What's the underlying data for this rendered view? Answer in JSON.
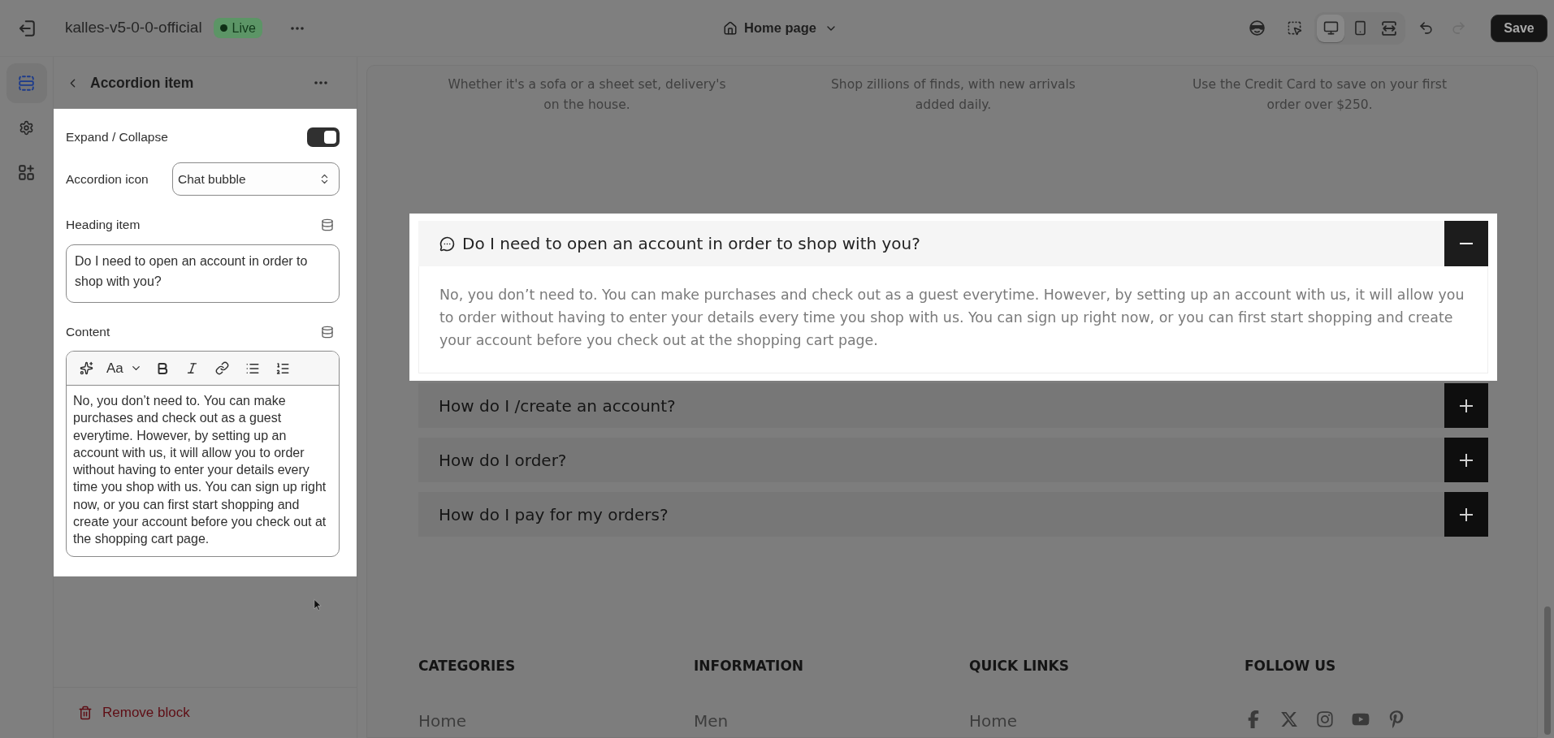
{
  "topbar": {
    "store_name": "kalles-v5-0-0-official",
    "status_badge": "Live",
    "page_selector": "Home page",
    "view_modes": [
      {
        "kind": "desktop",
        "selected": true
      },
      {
        "kind": "mobile",
        "selected": false
      },
      {
        "kind": "full_width",
        "selected": false
      }
    ],
    "undo": {
      "disabled": false
    },
    "redo": {
      "disabled": true
    },
    "save_button": "Save"
  },
  "sidebar_rail": [
    {
      "kind": "sections",
      "selected": true
    },
    {
      "kind": "theme_settings",
      "selected": false
    },
    {
      "kind": "apps",
      "selected": false
    }
  ],
  "block_panel": {
    "title": "Accordion item",
    "settings": [
      {
        "kind": "toggle",
        "label": "Expand / Collapse",
        "on": true
      },
      {
        "kind": "select",
        "label": "Accordion icon",
        "value": "Chat bubble"
      },
      {
        "kind": "text",
        "label": "Heading item",
        "value": "Do I need to open an account in order to shop with you?"
      },
      {
        "kind": "richtext",
        "label": "Content",
        "toolbar_text": "Aa",
        "value": "No, you don’t need to. You can make purchases and check out as a guest everytime. However, by setting up an account with us, it will allow you to order without having to enter your details every time you shop with us. You can sign up right now, or you can first start shopping and create your account before you check out at the shopping cart page."
      }
    ],
    "remove_button": "Remove block"
  },
  "preview": {
    "features": [
      "Whether it's a sofa or a sheet set, delivery's on the house.",
      "Shop zillions of finds, with new arrivals added daily.",
      "Use the Credit Card to save on your first order over $250."
    ],
    "accordion": [
      {
        "kind": "with_icon",
        "question": "Do I need to open an account in order to shop with you?",
        "selected": true,
        "expanded": true,
        "answer": "No, you don’t need to. You can make purchases and check out as a guest everytime. However, by setting up an account with us, it will allow you to order without having to enter your details every time you shop with us. You can sign up right now, or you can first start shopping and create your account before you check out at the shopping cart page."
      },
      {
        "kind": "plain",
        "question": "How do I /create an account?",
        "selected": false,
        "expanded": false
      },
      {
        "kind": "plain",
        "question": "How do I order?",
        "selected": false,
        "expanded": false
      },
      {
        "kind": "plain",
        "question": "How do I pay for my orders?",
        "selected": false,
        "expanded": false
      }
    ],
    "footer": [
      {
        "heading": "CATEGORIES",
        "links": [
          "Home"
        ]
      },
      {
        "heading": "INFORMATION",
        "links": [
          "Men"
        ]
      },
      {
        "heading": "QUICK LINKS",
        "links": [
          "Home"
        ]
      },
      {
        "heading": "FOLLOW US",
        "social": [
          {
            "kind": "facebook"
          },
          {
            "kind": "x"
          },
          {
            "kind": "instagram"
          },
          {
            "kind": "youtube"
          },
          {
            "kind": "pinterest"
          }
        ]
      }
    ]
  }
}
